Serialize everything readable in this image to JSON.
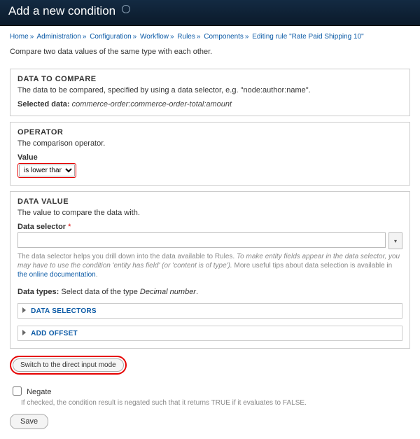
{
  "header": {
    "title": "Add a new condition"
  },
  "breadcrumbs": [
    "Home",
    "Administration",
    "Configuration",
    "Workflow",
    "Rules",
    "Components",
    "Editing rule \"Rate Paid Shipping 10\""
  ],
  "intro": "Compare two data values of the same type with each other.",
  "data_to_compare": {
    "title": "DATA TO COMPARE",
    "desc": "The data to be compared, specified by using a data selector, e.g. \"node:author:name\".",
    "selected_label": "Selected data:",
    "selected_value": "commerce-order:commerce-order-total:amount"
  },
  "operator": {
    "title": "OPERATOR",
    "desc": "The comparison operator.",
    "value_label": "Value",
    "selected": "is lower than"
  },
  "data_value": {
    "title": "DATA VALUE",
    "desc": "The value to compare the data with.",
    "selector_label": "Data selector",
    "help_plain": "The data selector helps you drill down into the data available to Rules. ",
    "help_em": "To make entity fields appear in the data selector, you may have to use the condition 'entity has field' (or 'content is of type').",
    "help_tail": " More useful tips about data selection is available in ",
    "help_link": "the online documentation",
    "types_label": "Data types:",
    "types_text": " Select data of the type ",
    "types_em": "Decimal number",
    "collapsibles": [
      {
        "label": "DATA SELECTORS"
      },
      {
        "label": "ADD OFFSET"
      }
    ],
    "switch_label": "Switch to the direct input mode"
  },
  "negate": {
    "label": "Negate",
    "help": "If checked, the condition result is negated such that it returns TRUE if it evaluates to FALSE."
  },
  "save_label": "Save"
}
